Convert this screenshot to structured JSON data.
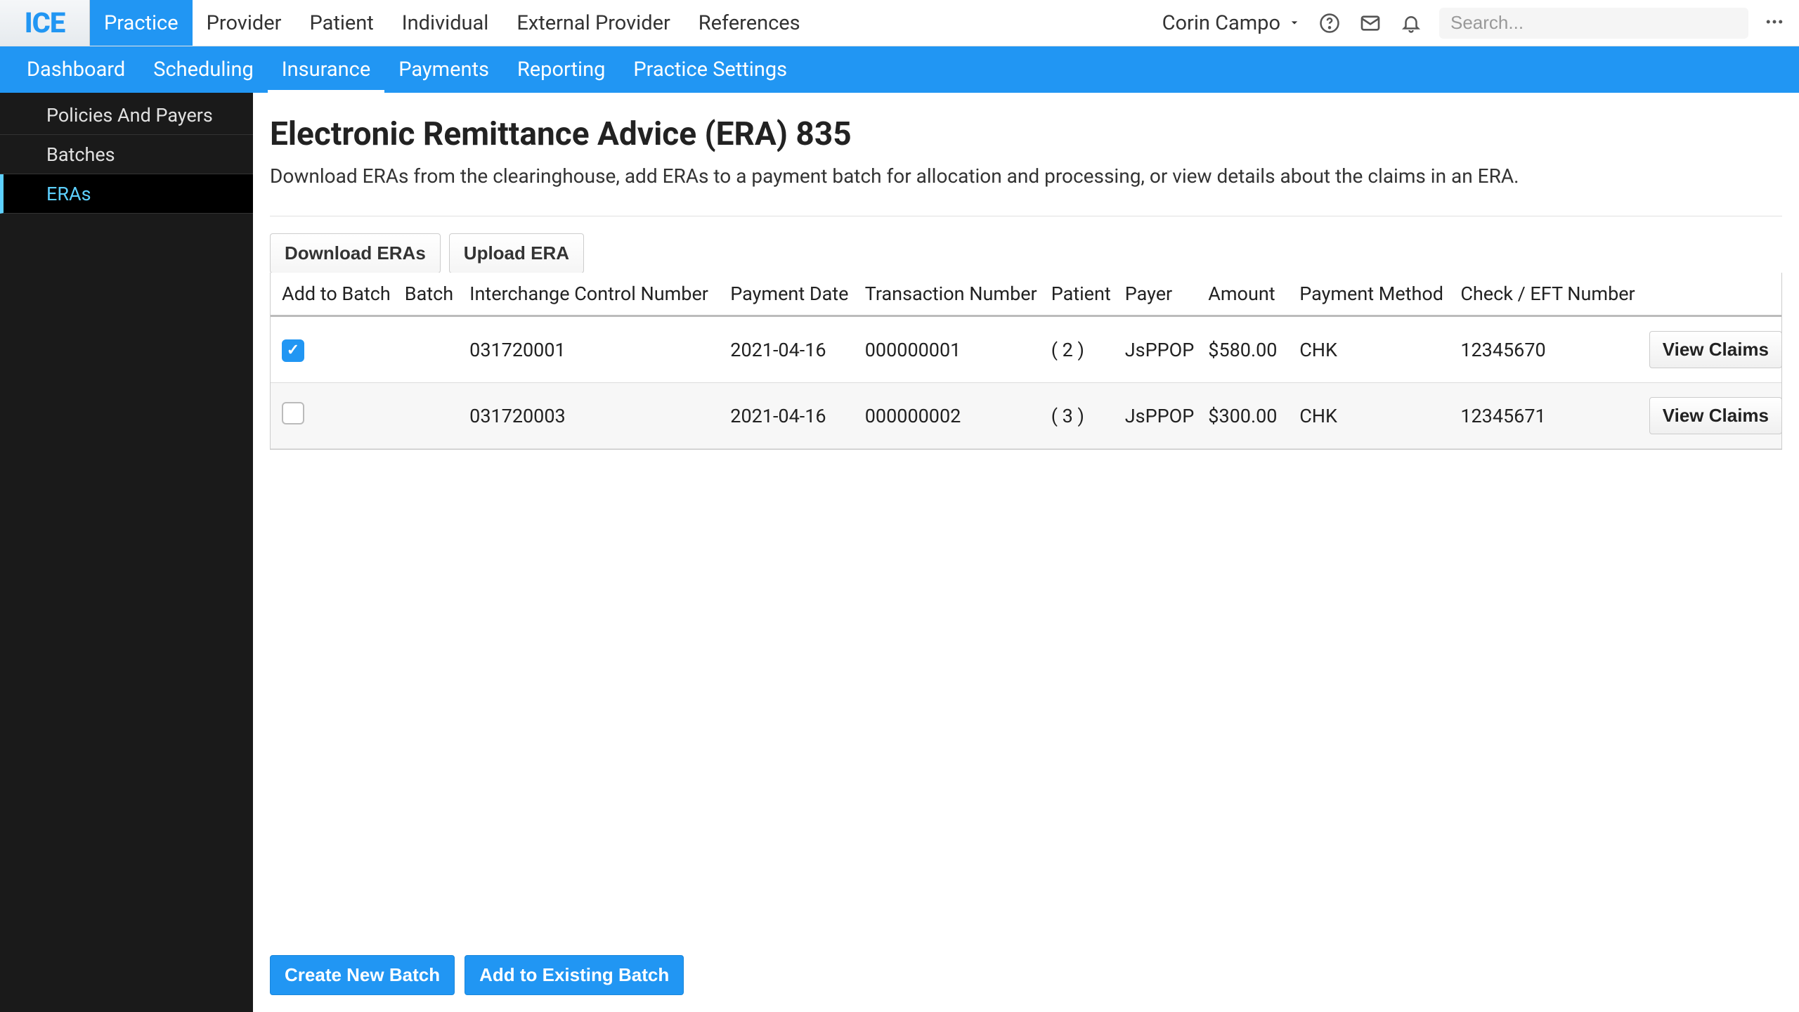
{
  "brand": {
    "name": "ICE"
  },
  "topnav": {
    "items": [
      "Practice",
      "Provider",
      "Patient",
      "Individual",
      "External Provider",
      "References"
    ],
    "active": 0
  },
  "user": {
    "name": "Corin Campo"
  },
  "search": {
    "placeholder": "Search..."
  },
  "subnav": {
    "items": [
      "Dashboard",
      "Scheduling",
      "Insurance",
      "Payments",
      "Reporting",
      "Practice Settings"
    ],
    "active": 2
  },
  "sidebar": {
    "items": [
      "Policies And Payers",
      "Batches",
      "ERAs"
    ],
    "active": 2
  },
  "page": {
    "title": "Electronic Remittance Advice (ERA) 835",
    "description": "Download ERAs from the clearinghouse, add ERAs to a payment batch for allocation and processing, or view details about the claims in an ERA."
  },
  "toolbar": {
    "download": "Download ERAs",
    "upload": "Upload ERA"
  },
  "table": {
    "headers": {
      "add_to_batch": "Add to Batch",
      "batch": "Batch",
      "icn": "Interchange Control Number",
      "payment_date": "Payment Date",
      "txn": "Transaction Number",
      "patient": "Patient",
      "payer": "Payer",
      "amount": "Amount",
      "payment_method": "Payment Method",
      "check": "Check / EFT Number",
      "action": "View Claims"
    },
    "rows": [
      {
        "checked": true,
        "batch": "",
        "icn": "031720001",
        "payment_date": "2021-04-16",
        "txn": "000000001",
        "patient": "( 2 )",
        "payer": "JsPPOP",
        "amount": "$580.00",
        "payment_method": "CHK",
        "check": "12345670"
      },
      {
        "checked": false,
        "batch": "",
        "icn": "031720003",
        "payment_date": "2021-04-16",
        "txn": "000000002",
        "patient": "( 3 )",
        "payer": "JsPPOP",
        "amount": "$300.00",
        "payment_method": "CHK",
        "check": "12345671"
      }
    ]
  },
  "footer": {
    "create": "Create New Batch",
    "add": "Add to Existing Batch"
  }
}
